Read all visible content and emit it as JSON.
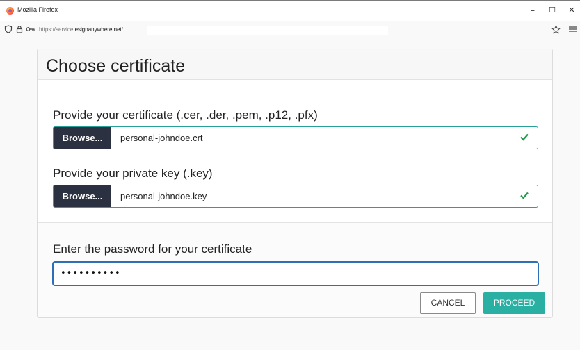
{
  "window": {
    "title": "Mozilla Firefox",
    "minimize": "–",
    "maximize": "☐",
    "close": "✕"
  },
  "navbar": {
    "url_prefix": "https://service.",
    "url_domain": "esignanywhere.net",
    "url_suffix": "/",
    "icons": [
      "shield-icon",
      "lock-icon",
      "key-icon",
      "bookmark-star-icon",
      "menu-icon"
    ]
  },
  "dialog": {
    "title": "Choose certificate",
    "certificate": {
      "label": "Provide your certificate (.cer, .der, .pem, .p12, .pfx)",
      "browse": "Browse...",
      "file_name": "personal-johndoe.crt"
    },
    "private_key": {
      "label": "Provide your private key (.key)",
      "browse": "Browse...",
      "file_name": "personal-johndoe.key"
    },
    "password": {
      "label": "Enter the password for your certificate",
      "value": "••••••••••"
    },
    "cancel": "CANCEL",
    "proceed": "PROCEED"
  },
  "colors": {
    "accent": "#2ab0a3",
    "browse_bg": "#2b3140",
    "valid_border": "#28a09a",
    "check": "#1f9a4c",
    "focus": "#2f6fb6"
  }
}
